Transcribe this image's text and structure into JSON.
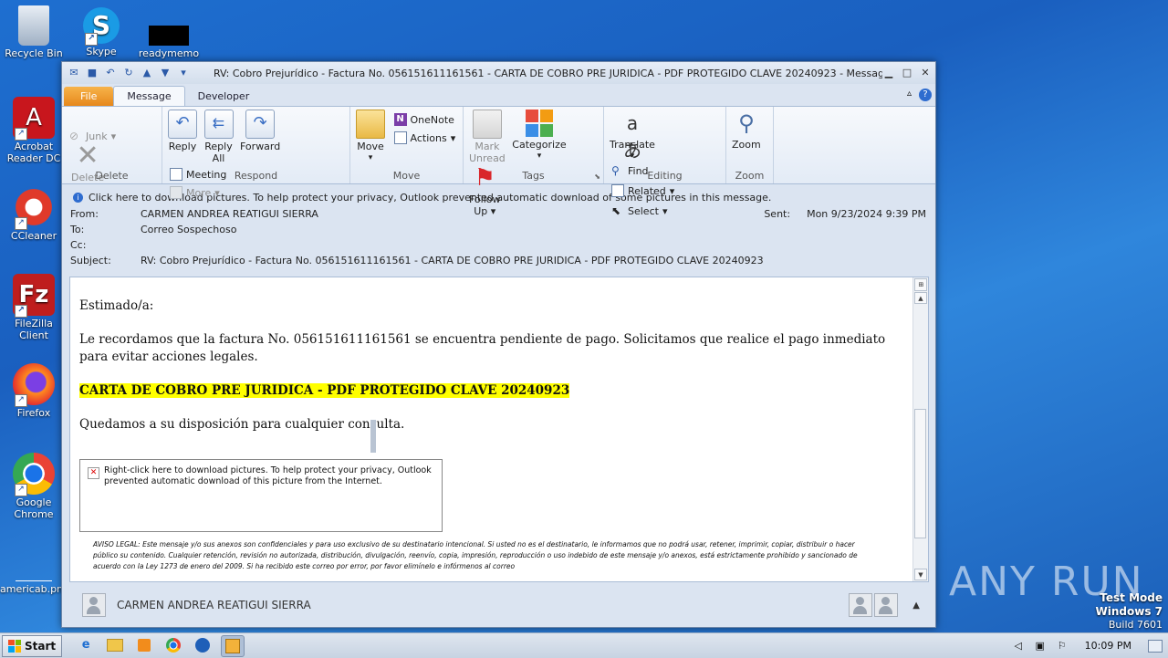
{
  "desktop": {
    "icons": [
      {
        "label": "Recycle Bin"
      },
      {
        "label": "Skype"
      },
      {
        "label": "readymemo"
      },
      {
        "label": "Acrobat Reader DC"
      },
      {
        "label": "CCleaner"
      },
      {
        "label": "FileZilla Client"
      },
      {
        "label": "Firefox"
      },
      {
        "label": "Google Chrome"
      },
      {
        "label": "americab.png"
      }
    ],
    "watermark": "ANY RUN",
    "test_mode": {
      "line1": "Test Mode",
      "line2": "Windows 7",
      "line3": "Build 7601"
    }
  },
  "window": {
    "title": "RV: Cobro Prejurídico - Factura No. 056151611161561 - CARTA DE COBRO PRE JURIDICA - PDF PROTEGIDO CLAVE 20240923  -  Message (HTM...",
    "tabs": {
      "file": "File",
      "message": "Message",
      "developer": "Developer"
    }
  },
  "ribbon": {
    "delete_group": {
      "label": "Delete",
      "junk": "Junk",
      "delete": "Delete"
    },
    "respond_group": {
      "label": "Respond",
      "reply": "Reply",
      "reply_all_1": "Reply",
      "reply_all_2": "All",
      "forward": "Forward",
      "meeting": "Meeting",
      "more": "More"
    },
    "move_group": {
      "label": "Move",
      "move": "Move",
      "onenote": "OneNote",
      "actions": "Actions"
    },
    "tags_group": {
      "label": "Tags",
      "mark_unread_1": "Mark",
      "mark_unread_2": "Unread",
      "categorize": "Categorize",
      "follow_up_1": "Follow",
      "follow_up_2": "Up"
    },
    "editing_group": {
      "label": "Editing",
      "translate": "Translate",
      "find": "Find",
      "related": "Related",
      "select": "Select"
    },
    "zoom_group": {
      "label": "Zoom",
      "zoom": "Zoom"
    }
  },
  "infobar": "Click here to download pictures. To help protect your privacy, Outlook prevented automatic download of some pictures in this message.",
  "headers": {
    "from_label": "From:",
    "from": "CARMEN ANDREA REATIGUI SIERRA",
    "to_label": "To:",
    "to": "Correo Sospechoso",
    "cc_label": "Cc:",
    "cc": "",
    "subject_label": "Subject:",
    "subject": "RV: Cobro Prejurídico - Factura No. 056151611161561 - CARTA DE COBRO PRE JURIDICA - PDF PROTEGIDO CLAVE 20240923",
    "sent_label": "Sent:",
    "sent": "Mon 9/23/2024 9:39 PM"
  },
  "message": {
    "greeting": "Estimado/a:",
    "paragraph1": "Le recordamos que la factura No. 056151611161561 se encuentra pendiente de pago. Solicitamos que realice el pago inmediato para evitar acciones legales.",
    "highlight": "CARTA DE COBRO PRE JURIDICA - PDF PROTEGIDO CLAVE 20240923",
    "closing": "Quedamos a su disposición para cualquier consulta.",
    "image_placeholder": "Right-click here to download pictures.  To help protect your privacy, Outlook prevented automatic download of this picture from the Internet.",
    "legal_1": "AVISO LEGAL: Este mensaje y/o sus anexos son confidenciales y para uso exclusivo de su destinatario intencional. Si usted no es el destinatario, le informamos que no podrá usar, retener, imprimir, copiar, distribuir o hacer",
    "legal_2": "público su contenido. Cualquier retención, revisión no autorizada, distribución, divulgación, reenvío, copia, impresión, reproducción o uso indebido de este mensaje y/o anexos, está estrictamente prohibido y sancionado de",
    "legal_3": "acuerdo con la Ley 1273 de enero del 2009. Si ha recibido este correo por error, por favor elimínelo e infórmenos al correo"
  },
  "people_pane": {
    "name": "CARMEN ANDREA REATIGUI SIERRA"
  },
  "taskbar": {
    "start": "Start",
    "clock": "10:09 PM"
  }
}
